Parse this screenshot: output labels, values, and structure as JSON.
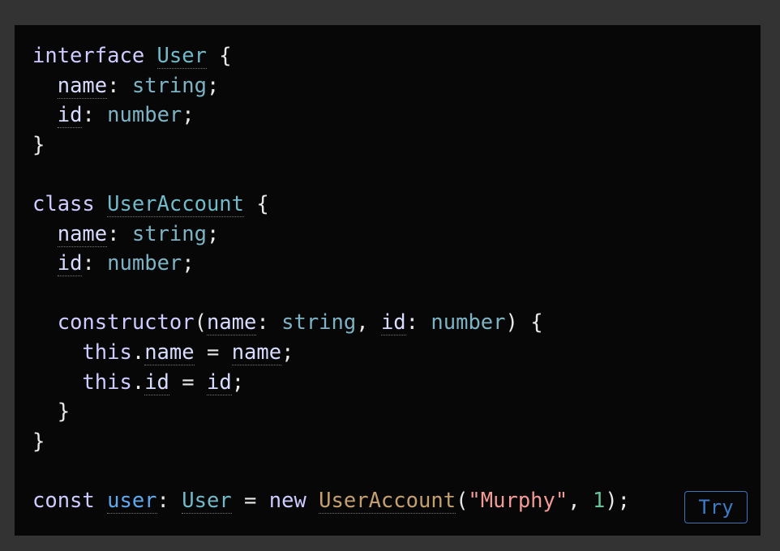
{
  "code": {
    "lines": [
      [
        {
          "t": "interface",
          "c": "kw"
        },
        {
          "t": " "
        },
        {
          "t": "User",
          "c": "cls",
          "u": true
        },
        {
          "t": " {"
        }
      ],
      [
        {
          "t": "  "
        },
        {
          "t": "name",
          "c": "prop",
          "u": true
        },
        {
          "t": ": "
        },
        {
          "t": "string",
          "c": "type"
        },
        {
          "t": ";"
        }
      ],
      [
        {
          "t": "  "
        },
        {
          "t": "id",
          "c": "prop",
          "u": true
        },
        {
          "t": ": "
        },
        {
          "t": "number",
          "c": "type"
        },
        {
          "t": ";"
        }
      ],
      [
        {
          "t": "}"
        }
      ],
      [],
      [
        {
          "t": "class",
          "c": "kw"
        },
        {
          "t": " "
        },
        {
          "t": "UserAccount",
          "c": "cls",
          "u": true
        },
        {
          "t": " {"
        }
      ],
      [
        {
          "t": "  "
        },
        {
          "t": "name",
          "c": "prop",
          "u": true
        },
        {
          "t": ": "
        },
        {
          "t": "string",
          "c": "type"
        },
        {
          "t": ";"
        }
      ],
      [
        {
          "t": "  "
        },
        {
          "t": "id",
          "c": "prop",
          "u": true
        },
        {
          "t": ": "
        },
        {
          "t": "number",
          "c": "type"
        },
        {
          "t": ";"
        }
      ],
      [],
      [
        {
          "t": "  "
        },
        {
          "t": "constructor",
          "c": "kw"
        },
        {
          "t": "("
        },
        {
          "t": "name",
          "c": "prop",
          "u": true
        },
        {
          "t": ": "
        },
        {
          "t": "string",
          "c": "type"
        },
        {
          "t": ", "
        },
        {
          "t": "id",
          "c": "prop",
          "u": true
        },
        {
          "t": ": "
        },
        {
          "t": "number",
          "c": "type"
        },
        {
          "t": ") {"
        }
      ],
      [
        {
          "t": "    "
        },
        {
          "t": "this",
          "c": "kw"
        },
        {
          "t": "."
        },
        {
          "t": "name",
          "c": "prop",
          "u": true
        },
        {
          "t": " = "
        },
        {
          "t": "name",
          "c": "prop",
          "u": true
        },
        {
          "t": ";"
        }
      ],
      [
        {
          "t": "    "
        },
        {
          "t": "this",
          "c": "kw"
        },
        {
          "t": "."
        },
        {
          "t": "id",
          "c": "prop",
          "u": true
        },
        {
          "t": " = "
        },
        {
          "t": "id",
          "c": "prop",
          "u": true
        },
        {
          "t": ";"
        }
      ],
      [
        {
          "t": "  }"
        }
      ],
      [
        {
          "t": "}"
        }
      ],
      [],
      [
        {
          "t": "const",
          "c": "kw"
        },
        {
          "t": " "
        },
        {
          "t": "user",
          "c": "var",
          "u": true
        },
        {
          "t": ": "
        },
        {
          "t": "User",
          "c": "cls",
          "u": true
        },
        {
          "t": " = "
        },
        {
          "t": "new",
          "c": "kw"
        },
        {
          "t": " "
        },
        {
          "t": "UserAccount",
          "c": "fn-cls",
          "u": true
        },
        {
          "t": "("
        },
        {
          "t": "\"Murphy\"",
          "c": "str"
        },
        {
          "t": ", "
        },
        {
          "t": "1",
          "c": "num"
        },
        {
          "t": ");"
        }
      ]
    ]
  },
  "try_button": {
    "label": "Try"
  },
  "colors": {
    "background": "#333333",
    "panel": "#070707",
    "keyword": "#cdcbff",
    "type": "#7db3c4",
    "string": "#f29a95",
    "number": "#66c39a",
    "button": "#3d7cc9"
  }
}
